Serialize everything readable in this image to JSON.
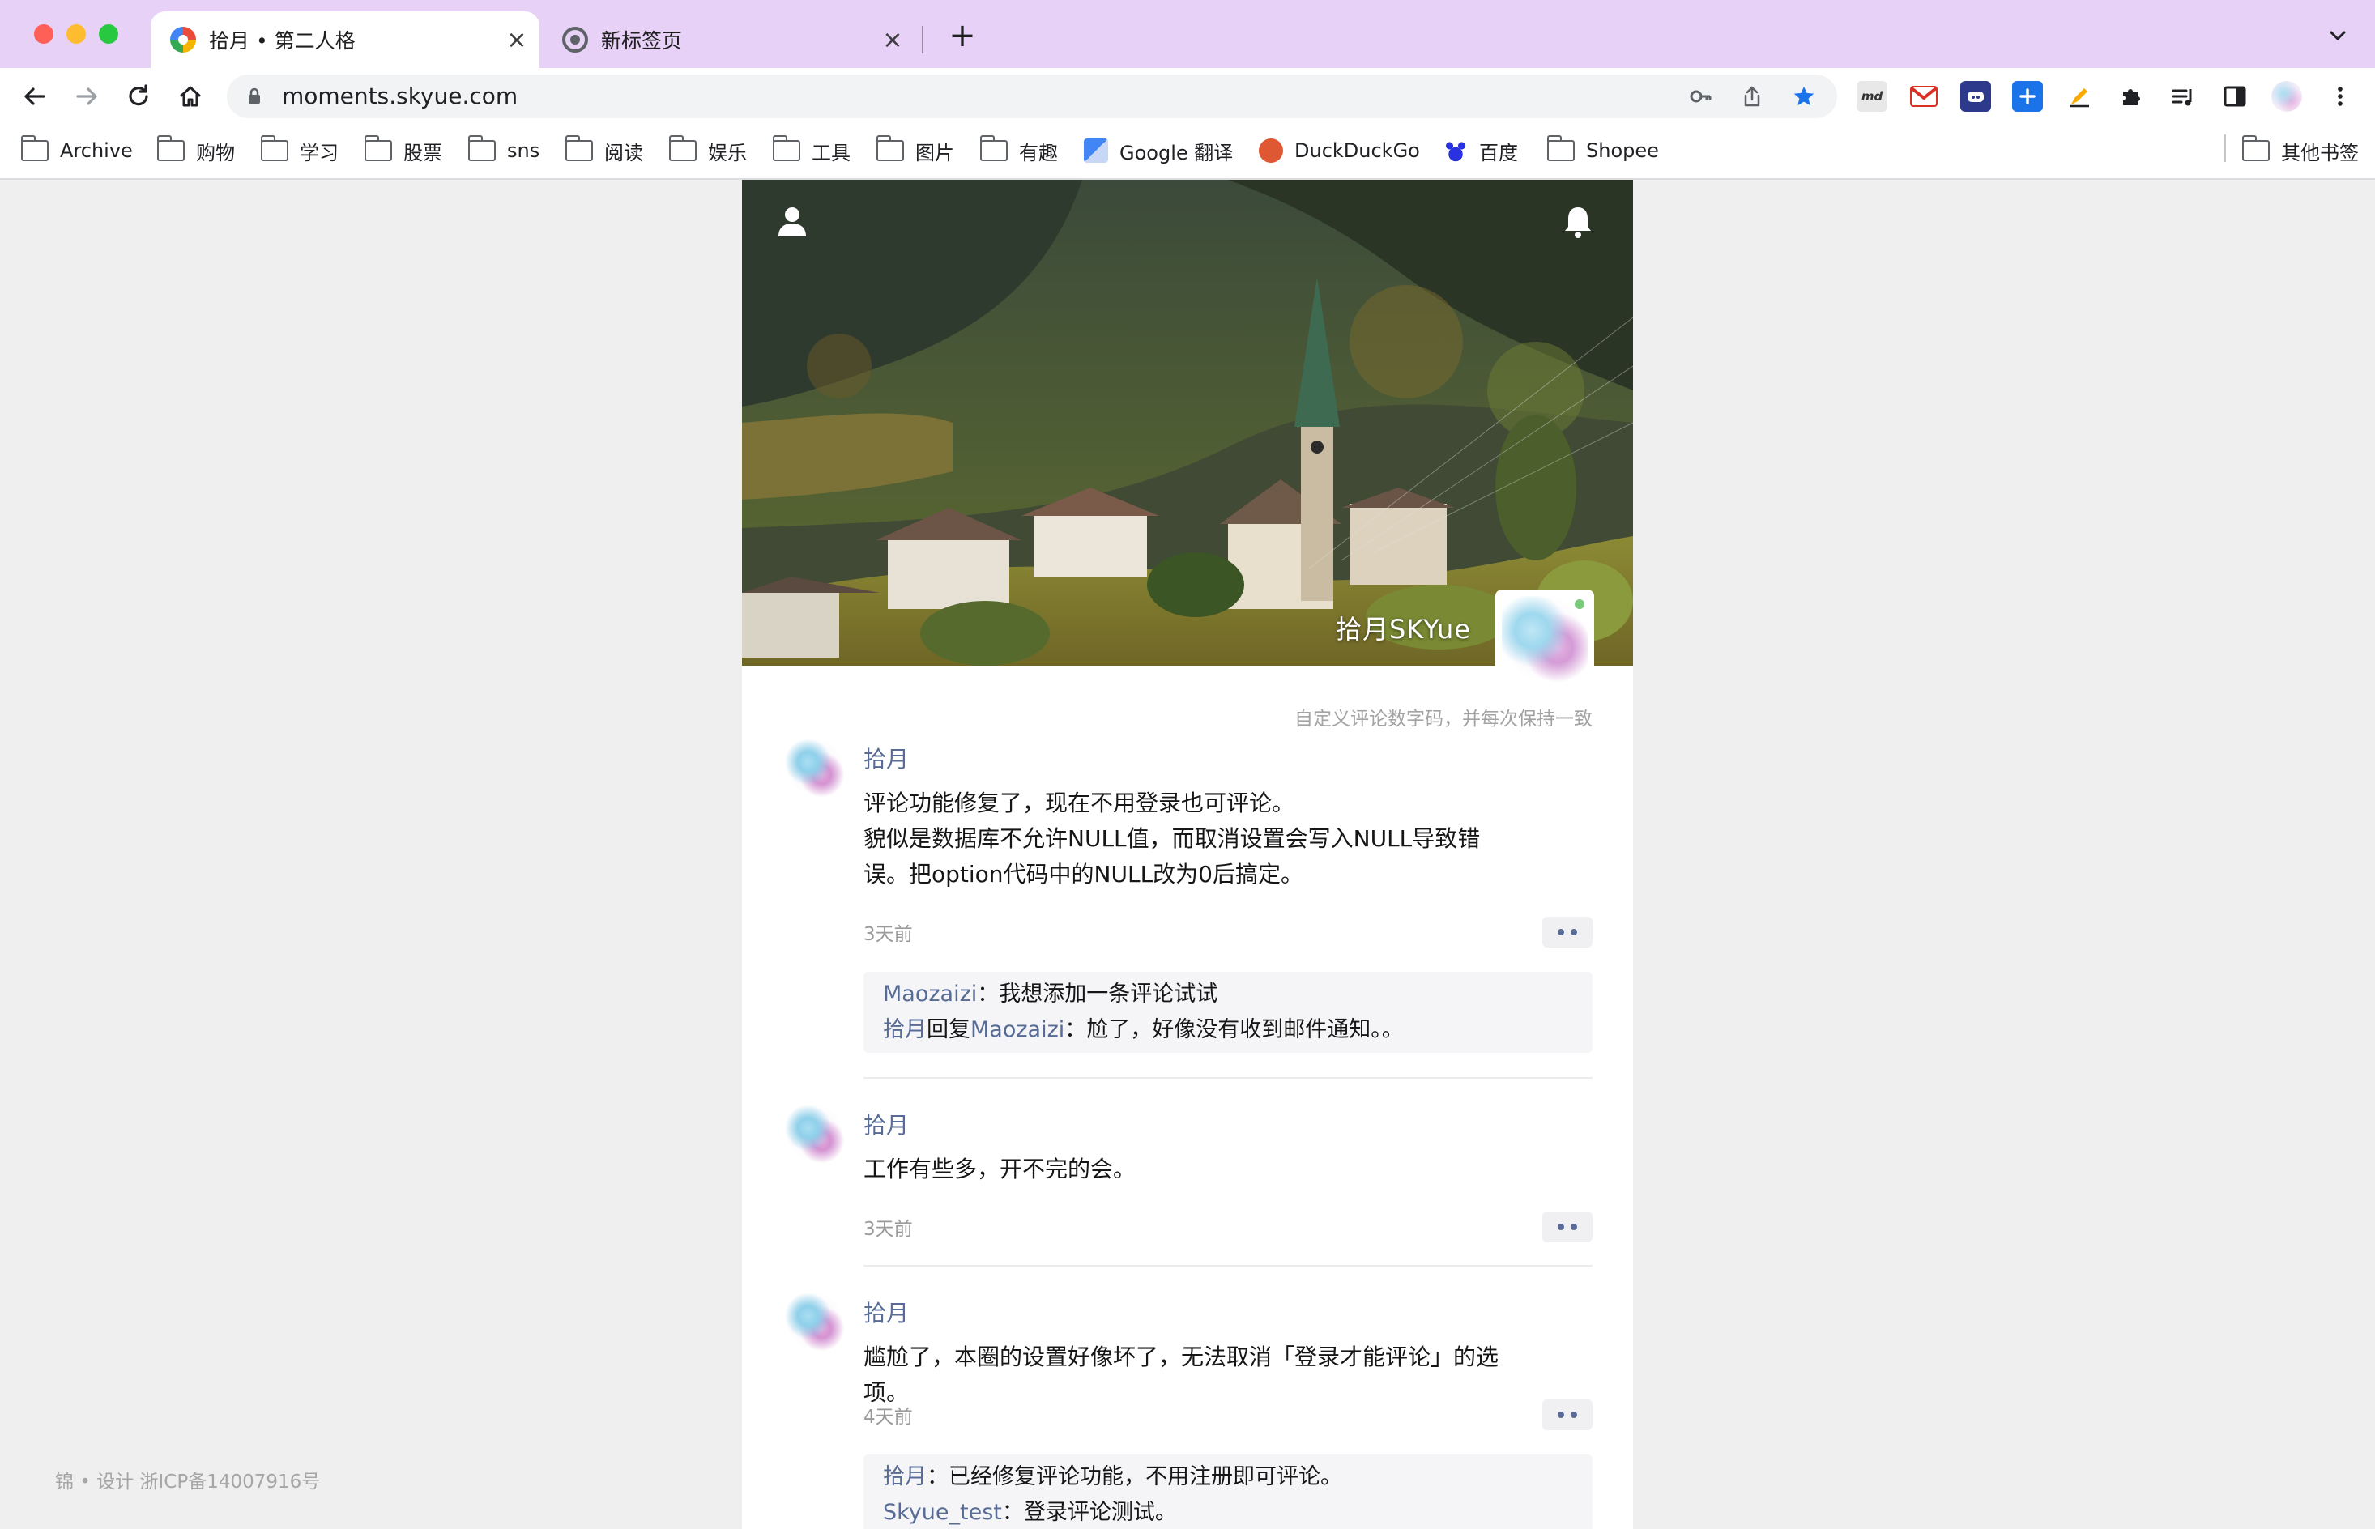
{
  "browser": {
    "tabs": [
      {
        "title": "拾月 • 第二人格",
        "active": true
      },
      {
        "title": "新标签页",
        "active": false
      }
    ],
    "close_glyph": "×",
    "new_tab_glyph": "+",
    "url": "moments.skyue.com",
    "extensions": [
      {
        "name": "markdown-ext-icon",
        "label": "md"
      },
      {
        "name": "gmail-icon",
        "label": ""
      },
      {
        "name": "discord-ext-icon",
        "label": ""
      },
      {
        "name": "plus-ext-icon",
        "label": ""
      },
      {
        "name": "pen-ext-icon",
        "label": ""
      },
      {
        "name": "extensions-puzzle-icon",
        "label": ""
      },
      {
        "name": "reading-list-icon",
        "label": ""
      },
      {
        "name": "side-panel-icon",
        "label": ""
      },
      {
        "name": "profile-avatar-icon",
        "label": ""
      }
    ]
  },
  "bookmarks": {
    "items": [
      {
        "label": "Archive",
        "type": "folder"
      },
      {
        "label": "购物",
        "type": "folder"
      },
      {
        "label": "学习",
        "type": "folder"
      },
      {
        "label": "股票",
        "type": "folder"
      },
      {
        "label": "sns",
        "type": "folder"
      },
      {
        "label": "阅读",
        "type": "folder"
      },
      {
        "label": "娱乐",
        "type": "folder"
      },
      {
        "label": "工具",
        "type": "folder"
      },
      {
        "label": "图片",
        "type": "folder"
      },
      {
        "label": "有趣",
        "type": "folder"
      },
      {
        "label": "Google 翻译",
        "type": "site",
        "icon": "google-translate-icon"
      },
      {
        "label": "DuckDuckGo",
        "type": "site",
        "icon": "duckduckgo-icon"
      },
      {
        "label": "百度",
        "type": "site",
        "icon": "baidu-icon"
      },
      {
        "label": "Shopee",
        "type": "folder"
      }
    ],
    "other": "其他书签"
  },
  "page": {
    "footer": "锦 • 设计  浙ICP备14007916号",
    "profile_name": "拾月SKYue",
    "custom_note": "自定义评论数字码，并每次保持一致",
    "posts": [
      {
        "author": "拾月",
        "text": "评论功能修复了，现在不用登录也可评论。\n貌似是数据库不允许NULL值，而取消设置会写入NULL导致错误。把option代码中的NULL改为0后搞定。",
        "time": "3天前",
        "comments": [
          {
            "author": "Maozaizi",
            "reply_word": "",
            "reply_to": "",
            "sep": "：",
            "text": "我想添加一条评论试试"
          },
          {
            "author": "拾月",
            "reply_word": "回复",
            "reply_to": "Maozaizi",
            "sep": "：",
            "text": "尬了，好像没有收到邮件通知。。"
          }
        ]
      },
      {
        "author": "拾月",
        "text": "工作有些多，开不完的会。",
        "time": "3天前",
        "comments": []
      },
      {
        "author": "拾月",
        "text": "尴尬了，本圈的设置好像坏了，无法取消「登录才能评论」的选项。",
        "time": "4天前",
        "comments": [
          {
            "author": "拾月",
            "reply_word": "",
            "reply_to": "",
            "sep": "：",
            "text": "已经修复评论功能，不用注册即可评论。"
          },
          {
            "author": "Skyue_test",
            "reply_word": "",
            "reply_to": "",
            "sep": "：",
            "text": "登录评论测试。"
          }
        ]
      }
    ]
  },
  "colors": {
    "tabstrip_bg": "#e7d1f7",
    "link_blue": "#576b95",
    "page_bg": "#efefef",
    "star_blue": "#1a73e8"
  }
}
